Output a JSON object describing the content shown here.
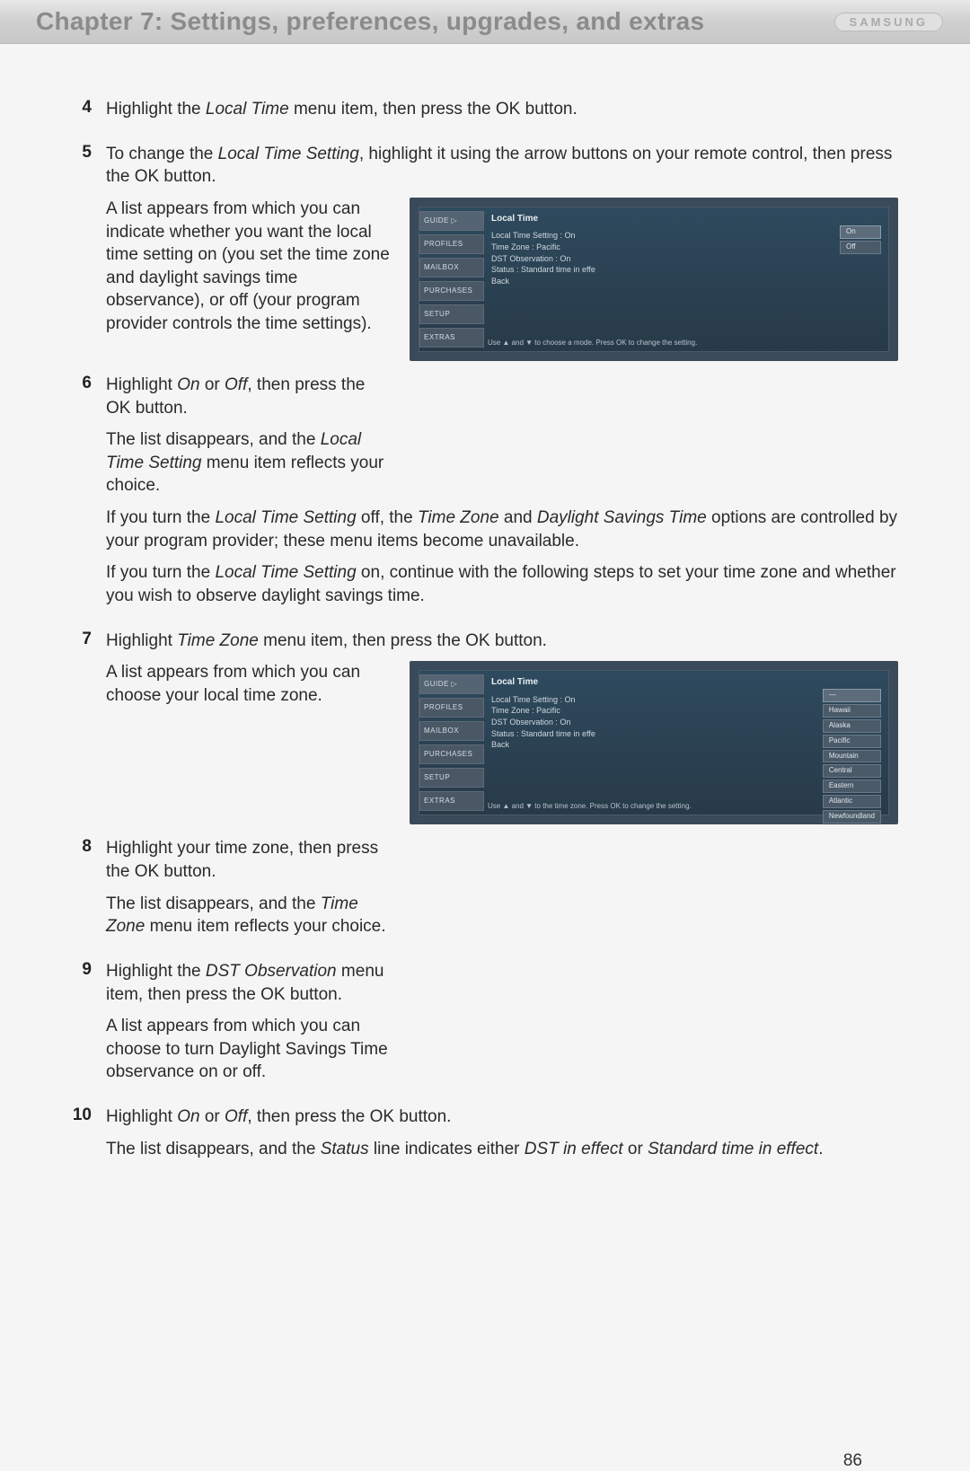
{
  "header": {
    "chapter_title": "Chapter 7: Settings, preferences, upgrades, and extras",
    "brand": "SAMSUNG"
  },
  "steps": [
    {
      "num": "4",
      "paragraphs": [
        {
          "runs": [
            {
              "t": "Highlight the "
            },
            {
              "t": "Local Time",
              "i": true
            },
            {
              "t": " menu item, then press the OK button."
            }
          ]
        }
      ]
    },
    {
      "num": "5",
      "paragraphs": [
        {
          "runs": [
            {
              "t": "To change the "
            },
            {
              "t": "Local Time Setting",
              "i": true
            },
            {
              "t": ", highlight it using the arrow buttons on your remote control, then press the OK button."
            }
          ]
        }
      ],
      "figure_block": {
        "text_paragraphs": [
          {
            "runs": [
              {
                "t": "A list appears from which you can indicate whether you want the local time setting on (you set the time zone and daylight savings time observance), or off (your program provider controls the time settings)."
              }
            ]
          }
        ],
        "figure": "fig1"
      }
    },
    {
      "num": "6",
      "paragraphs": [],
      "figure_block_continued": {
        "text_paragraphs": [
          {
            "runs": [
              {
                "t": "Highlight "
              },
              {
                "t": "On",
                "i": true
              },
              {
                "t": " or "
              },
              {
                "t": "Off",
                "i": true
              },
              {
                "t": ", then press the OK button."
              }
            ]
          },
          {
            "runs": [
              {
                "t": "The list disappears, and the "
              },
              {
                "t": "Local Time Setting",
                "i": true
              },
              {
                "t": " menu item reflects your choice."
              }
            ]
          }
        ]
      },
      "after_paragraphs": [
        {
          "runs": [
            {
              "t": "If you turn the "
            },
            {
              "t": "Local Time Setting",
              "i": true
            },
            {
              "t": " off, the "
            },
            {
              "t": "Time Zone",
              "i": true
            },
            {
              "t": " and "
            },
            {
              "t": "Daylight Savings Time",
              "i": true
            },
            {
              "t": " options are controlled by your program provider; these menu items become unavailable."
            }
          ]
        },
        {
          "runs": [
            {
              "t": "If you turn the "
            },
            {
              "t": "Local Time Setting",
              "i": true
            },
            {
              "t": " on, continue with the following steps to set your time zone and whether you wish to observe daylight savings time."
            }
          ]
        }
      ]
    },
    {
      "num": "7",
      "paragraphs": [
        {
          "runs": [
            {
              "t": "Highlight "
            },
            {
              "t": "Time Zone",
              "i": true
            },
            {
              "t": " menu item, then press the OK button."
            }
          ]
        }
      ],
      "figure_block": {
        "text_paragraphs": [
          {
            "runs": [
              {
                "t": "A list appears from which you can choose your local time zone."
              }
            ]
          }
        ],
        "figure": "fig2"
      }
    },
    {
      "num": "8",
      "figure_block_continued": {
        "text_paragraphs": [
          {
            "runs": [
              {
                "t": "Highlight your time zone, then press the OK button."
              }
            ]
          },
          {
            "runs": [
              {
                "t": "The list disappears, and the "
              },
              {
                "t": "Time Zone",
                "i": true
              },
              {
                "t": " menu item reflects your choice."
              }
            ]
          }
        ]
      }
    },
    {
      "num": "9",
      "figure_block_continued": {
        "text_paragraphs": [
          {
            "runs": [
              {
                "t": "Highlight the "
              },
              {
                "t": "DST Observation",
                "i": true
              },
              {
                "t": " menu item, then press the OK button."
              }
            ]
          },
          {
            "runs": [
              {
                "t": "A list appears from which you can choose to turn Daylight Savings Time observance on or off."
              }
            ]
          }
        ]
      }
    },
    {
      "num": "10",
      "paragraphs": [
        {
          "runs": [
            {
              "t": "Highlight "
            },
            {
              "t": "On",
              "i": true
            },
            {
              "t": " or "
            },
            {
              "t": "Off",
              "i": true
            },
            {
              "t": ", then press the OK button."
            }
          ]
        },
        {
          "runs": [
            {
              "t": "The list disappears, and the "
            },
            {
              "t": "Status",
              "i": true
            },
            {
              "t": " line indicates either "
            },
            {
              "t": "DST in effect",
              "i": true
            },
            {
              "t": " or "
            },
            {
              "t": "Standard time in effect",
              "i": true
            },
            {
              "t": "."
            }
          ]
        }
      ]
    }
  ],
  "figures": {
    "fig1": {
      "title": "Local Time",
      "sidebar": [
        "GUIDE  ▷",
        "PROFILES",
        "MAILBOX",
        "PURCHASES",
        "SETUP",
        "EXTRAS"
      ],
      "lines": [
        "Local Time Setting : On",
        "Time Zone : Pacific",
        "DST Observation : On",
        "Status : Standard time in effe",
        "Back"
      ],
      "options": [
        "On",
        "Off"
      ],
      "hint": "Use ▲ and ▼ to choose a mode.\nPress OK to change the setting."
    },
    "fig2": {
      "title": "Local Time",
      "sidebar": [
        "GUIDE  ▷",
        "PROFILES",
        "MAILBOX",
        "PURCHASES",
        "SETUP",
        "EXTRAS"
      ],
      "lines": [
        "Local Time Setting : On",
        "Time Zone : Pacific",
        "DST Observation : On",
        "Status : Standard time in effe",
        "Back"
      ],
      "options": [
        "—",
        "Hawaii",
        "Alaska",
        "Pacific",
        "Mountain",
        "Central",
        "Eastern",
        "Atlantic",
        "Newfoundland"
      ],
      "hint": "Use ▲ and ▼ to the time zone.\nPress OK to change the setting."
    }
  },
  "page_number": "86"
}
